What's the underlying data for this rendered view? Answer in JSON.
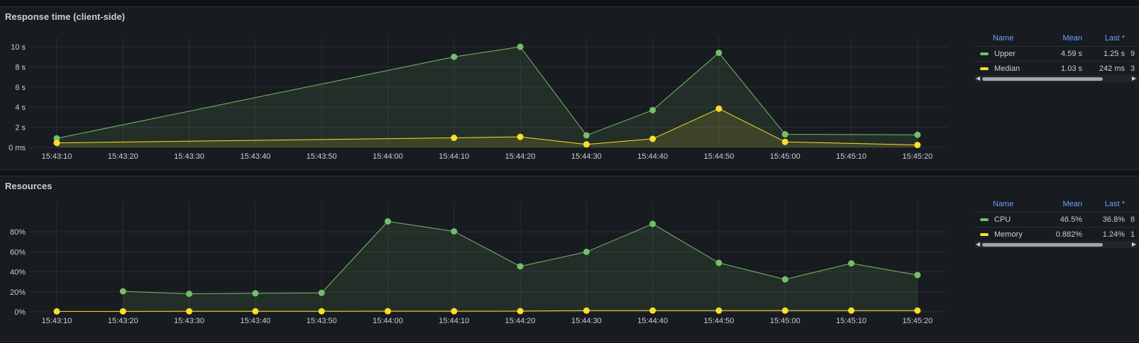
{
  "x_ticks": [
    "15:43:10",
    "15:43:20",
    "15:43:30",
    "15:43:40",
    "15:43:50",
    "15:44:00",
    "15:44:10",
    "15:44:20",
    "15:44:30",
    "15:44:40",
    "15:44:50",
    "15:45:00",
    "15:45:10",
    "15:45:20"
  ],
  "panels": [
    {
      "title": "Response time (client-side)",
      "legend": {
        "headers": [
          "Name",
          "Mean",
          "Last *"
        ],
        "rows": [
          {
            "name": "Upper",
            "mean": "4.59 s",
            "last": "1.25 s",
            "extra": "9",
            "color": "#73bf69"
          },
          {
            "name": "Median",
            "mean": "1.03 s",
            "last": "242 ms",
            "extra": "3",
            "color": "#fade2a"
          }
        ]
      },
      "chart_data": {
        "type": "line",
        "ylim": [
          0,
          10
        ],
        "y_ticks": [
          {
            "value": 0,
            "label": "0 ms"
          },
          {
            "value": 2,
            "label": "2 s"
          },
          {
            "value": 4,
            "label": "4 s"
          },
          {
            "value": 6,
            "label": "6 s"
          },
          {
            "value": 8,
            "label": "8 s"
          },
          {
            "value": 10,
            "label": "10 s"
          }
        ],
        "series": [
          {
            "name": "Upper",
            "color": "#73bf69",
            "fill": true,
            "x": [
              "15:43:10",
              "15:44:10",
              "15:44:20",
              "15:44:30",
              "15:44:40",
              "15:44:50",
              "15:45:00",
              "15:45:20"
            ],
            "values": [
              0.9,
              9.0,
              10.0,
              1.2,
              3.7,
              9.4,
              1.3,
              1.25
            ]
          },
          {
            "name": "Median",
            "color": "#fade2a",
            "fill": true,
            "x": [
              "15:43:10",
              "15:44:10",
              "15:44:20",
              "15:44:30",
              "15:44:40",
              "15:44:50",
              "15:45:00",
              "15:45:20"
            ],
            "values": [
              0.45,
              0.95,
              1.05,
              0.3,
              0.85,
              3.85,
              0.55,
              0.242
            ]
          }
        ]
      }
    },
    {
      "title": "Resources",
      "legend": {
        "headers": [
          "Name",
          "Mean",
          "Last *"
        ],
        "rows": [
          {
            "name": "CPU",
            "mean": "46.5%",
            "last": "36.8%",
            "extra": "8",
            "color": "#73bf69"
          },
          {
            "name": "Memory",
            "mean": "0.882%",
            "last": "1.24%",
            "extra": "1",
            "color": "#fade2a"
          }
        ]
      },
      "chart_data": {
        "type": "line",
        "ylim": [
          0,
          100
        ],
        "y_ticks": [
          {
            "value": 0,
            "label": "0%"
          },
          {
            "value": 20,
            "label": "20%"
          },
          {
            "value": 40,
            "label": "40%"
          },
          {
            "value": 60,
            "label": "60%"
          },
          {
            "value": 80,
            "label": "80%"
          }
        ],
        "series": [
          {
            "name": "CPU",
            "color": "#73bf69",
            "fill": true,
            "x": [
              "15:43:20",
              "15:43:30",
              "15:43:40",
              "15:43:50",
              "15:44:00",
              "15:44:10",
              "15:44:20",
              "15:44:30",
              "15:44:40",
              "15:44:50",
              "15:45:00",
              "15:45:10",
              "15:45:20"
            ],
            "values": [
              20.5,
              18,
              18.5,
              19,
              90.5,
              80.5,
              45.5,
              60,
              88,
              49,
              32.5,
              48.5,
              36.8
            ]
          },
          {
            "name": "Memory",
            "color": "#fade2a",
            "fill": false,
            "x": [
              "15:43:10",
              "15:43:20",
              "15:43:30",
              "15:43:40",
              "15:43:50",
              "15:44:00",
              "15:44:10",
              "15:44:20",
              "15:44:30",
              "15:44:40",
              "15:44:50",
              "15:45:00",
              "15:45:10",
              "15:45:20"
            ],
            "values": [
              0.4,
              0.45,
              0.5,
              0.5,
              0.55,
              0.6,
              0.6,
              0.7,
              1.2,
              1.25,
              1.2,
              1.2,
              1.24,
              1.24
            ]
          }
        ]
      }
    }
  ]
}
